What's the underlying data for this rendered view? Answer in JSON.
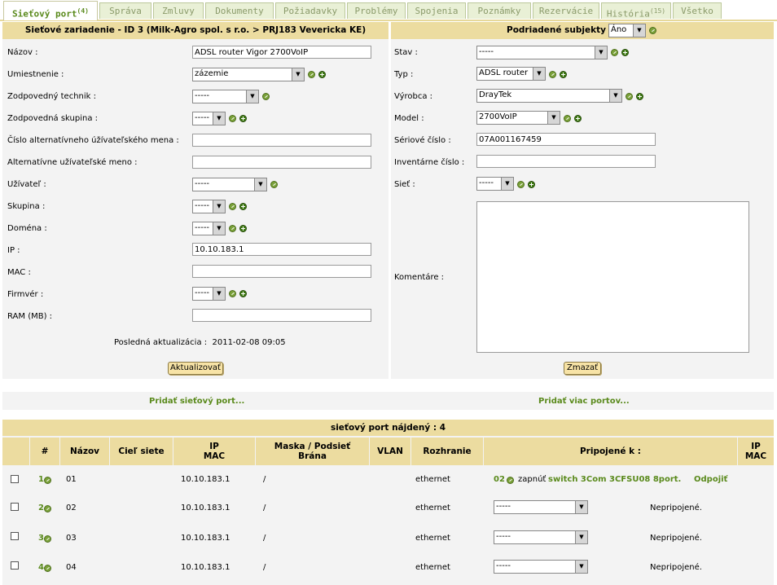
{
  "tabs": [
    {
      "label": "Sieťový port",
      "badge": "(4)",
      "active": true
    },
    {
      "label": "Správa",
      "badge": ""
    },
    {
      "label": "Zmluvy",
      "badge": ""
    },
    {
      "label": "Dokumenty",
      "badge": ""
    },
    {
      "label": "Požiadavky",
      "badge": ""
    },
    {
      "label": "Problémy",
      "badge": ""
    },
    {
      "label": "Spojenia",
      "badge": ""
    },
    {
      "label": "Poznámky",
      "badge": ""
    },
    {
      "label": "Rezervácie",
      "badge": ""
    },
    {
      "label": "História",
      "badge": "(15)"
    },
    {
      "label": "Všetko",
      "badge": ""
    }
  ],
  "device": {
    "header": "Sieťové zariadenie - ID 3 (Milk-Agro spol. s r.o. > PRJ183 Vevericka KE)",
    "labels": {
      "name": "Názov :",
      "location": "Umiestnenie :",
      "tech": "Zodpovedný technik :",
      "group_resp": "Zodpovedná skupina :",
      "alt_user_no": "Číslo alternatívneho úžívateľského mena :",
      "alt_user": "Alternatívne užívateľské meno :",
      "user": "Užívateľ :",
      "group": "Skupina :",
      "domain": "Doména :",
      "ip": "IP :",
      "mac": "MAC :",
      "firmware": "Firmvér :",
      "ram": "RAM (MB) :"
    },
    "values": {
      "name": "ADSL router Vigor 2700VoIP",
      "location": "zázemie",
      "tech": "-----",
      "group_resp": "-----",
      "alt_user_no": "",
      "alt_user": "",
      "user": "-----",
      "group": "-----",
      "domain": "-----",
      "ip": "10.10.183.1",
      "mac": "",
      "firmware": "-----",
      "ram": ""
    },
    "last_update_label": "Posledná aktualizácia :",
    "last_update": "2011-02-08 09:05",
    "update_button": "Aktualizovať"
  },
  "sub": {
    "header": "Podriadené subjekty :",
    "header_select": "Áno",
    "labels": {
      "state": "Stav :",
      "type": "Typ :",
      "maker": "Výrobca :",
      "model": "Model :",
      "serial": "Sériové číslo :",
      "inventory": "Inventárne číslo :",
      "network": "Sieť :",
      "comments": "Komentáre :"
    },
    "values": {
      "state": "-----",
      "type": "ADSL router",
      "maker": "DrayTek",
      "model": "2700VoIP",
      "serial": "07A001167459",
      "inventory": "",
      "network": "-----",
      "comments": ""
    },
    "delete_button": "Zmazať"
  },
  "links": {
    "add_port": "Pridať sieťový port...",
    "add_more": "Pridať viac portov..."
  },
  "ports": {
    "title": "sieťový port nájdený : 4",
    "columns": {
      "num": "#",
      "name": "Názov",
      "target": "Cieľ siete",
      "ip": "IP",
      "mac": "MAC",
      "mask": "Maska / Podsieť",
      "gateway": "Brána",
      "vlan": "VLAN",
      "iface": "Rozhranie",
      "connected": "Pripojené k :",
      "ip2": "IP",
      "mac2": "MAC"
    },
    "rows": [
      {
        "num": "1",
        "name": "01",
        "ip": "10.10.183.1",
        "mask": "/",
        "iface": "ethernet",
        "conn_port": "02",
        "conn_text": "zapnúť",
        "conn_device": "switch 3Com 3CFSU08 8port.",
        "disconnect": "Odpojiť",
        "status": ""
      },
      {
        "num": "2",
        "name": "02",
        "ip": "10.10.183.1",
        "mask": "/",
        "iface": "ethernet",
        "select": "-----",
        "status": "Nepripojené."
      },
      {
        "num": "3",
        "name": "03",
        "ip": "10.10.183.1",
        "mask": "/",
        "iface": "ethernet",
        "select": "-----",
        "status": "Nepripojené."
      },
      {
        "num": "4",
        "name": "04",
        "ip": "10.10.183.1",
        "mask": "/",
        "iface": "ethernet",
        "select": "-----",
        "status": "Nepripojené."
      }
    ]
  }
}
